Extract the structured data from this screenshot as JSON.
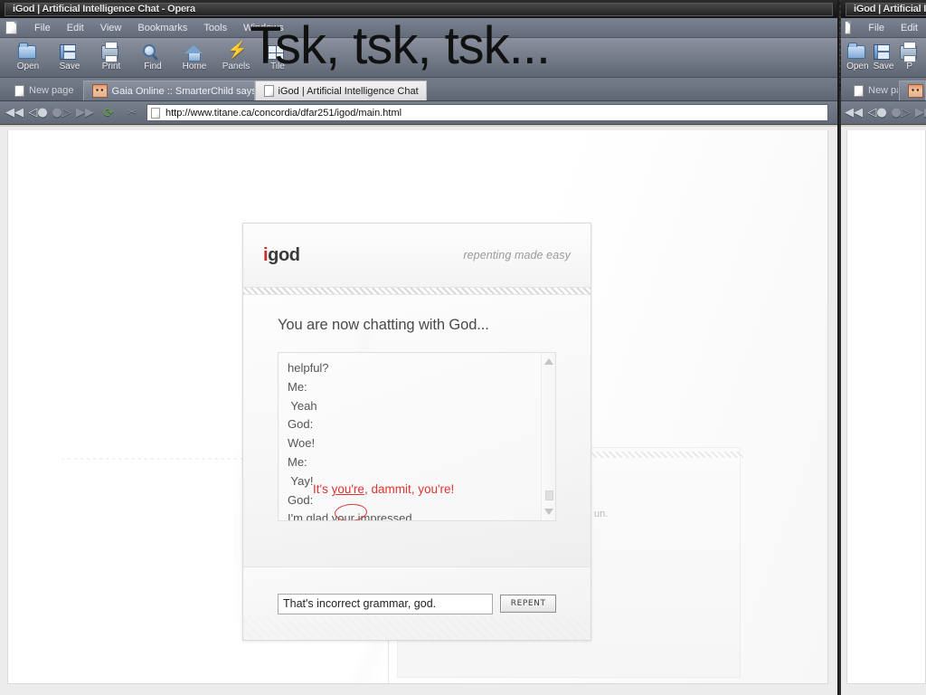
{
  "windows": {
    "main": {
      "title": "iGod | Artificial Intelligence Chat - Opera",
      "menu": [
        "File",
        "Edit",
        "View",
        "Bookmarks",
        "Tools",
        "Windows"
      ],
      "toolbar": [
        {
          "label": "Open",
          "icon": "open-folder-icon"
        },
        {
          "label": "Save",
          "icon": "floppy-disk-icon"
        },
        {
          "label": "Print",
          "icon": "printer-icon"
        },
        {
          "label": "Find",
          "icon": "magnifier-icon"
        },
        {
          "label": "Home",
          "icon": "home-icon"
        },
        {
          "label": "Panels",
          "icon": "lightning-icon"
        },
        {
          "label": "Tile",
          "icon": "tile-windows-icon"
        }
      ],
      "tabs": [
        {
          "label": "New page",
          "state": "plain",
          "icon": "blank-page-icon"
        },
        {
          "label": "Gaia Online :: SmarterChild says...",
          "state": "inactive",
          "icon": "avatar-icon"
        },
        {
          "label": "iGod | Artificial Intelligence Chat",
          "state": "active",
          "icon": "blank-page-icon"
        }
      ],
      "nav": {
        "fast_back": "◀◀",
        "back": "◁●",
        "forward": "●▷",
        "fast_forward": "▶▶",
        "reload": "⟳",
        "home": "✂"
      },
      "url": "http://www.titane.ca/concordia/dfar251/igod/main.html"
    },
    "right": {
      "title": "iGod | Artificial In",
      "menu": [
        "File",
        "Edit"
      ],
      "toolbar": [
        {
          "label": "Open",
          "icon": "open-folder-icon"
        },
        {
          "label": "Save",
          "icon": "floppy-disk-icon"
        },
        {
          "label": "P",
          "icon": "printer-icon"
        }
      ],
      "tabs": [
        {
          "label": "New page",
          "state": "plain",
          "icon": "blank-page-icon"
        },
        {
          "label": "",
          "state": "inactive",
          "icon": "avatar-icon"
        }
      ]
    }
  },
  "overlay": {
    "caption": "Tsk, tsk, tsk..."
  },
  "page": {
    "ghost_text": "un.",
    "igod": {
      "logo_i": "i",
      "logo_rest": "god",
      "tagline": "repenting made easy",
      "chat_title": "You are now chatting with God...",
      "transcript": [
        "helpful?",
        "Me:",
        " Yeah",
        "God:",
        "Woe!",
        "Me:",
        " Yay!",
        "God:",
        "I'm glad your impressed, ."
      ],
      "annotation": {
        "prefix": "It's ",
        "underlined": "you're",
        "suffix": ", dammit, you're!",
        "color": "#e33232",
        "circled_word": "your"
      },
      "input_value": "That's incorrect grammar, god.",
      "submit_label": "REPENT",
      "scrollbar": {
        "up": "up-arrow",
        "down": "down-arrow",
        "thumb": "thumb"
      }
    }
  },
  "colors": {
    "accent_red": "#d02b2b",
    "annotation_red": "#e33232",
    "chrome_blue_gray": "#747b89",
    "title_dark": "#232323"
  }
}
